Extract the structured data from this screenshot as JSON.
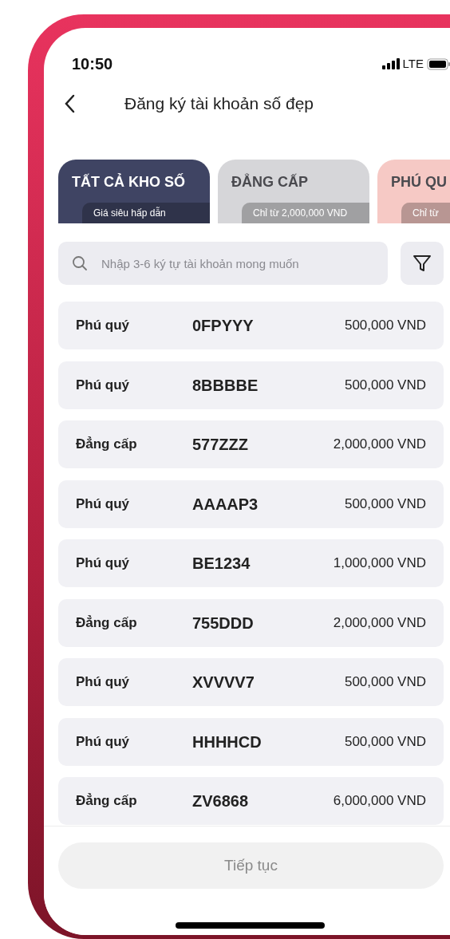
{
  "status_bar": {
    "time": "10:50",
    "network": "LTE"
  },
  "header": {
    "title": "Đăng ký tài khoản số đẹp"
  },
  "tabs": [
    {
      "label": "TẤT CẢ KHO SỐ",
      "subtitle": "Giá siêu hấp dẫn",
      "selected": true,
      "color": "#3f4463"
    },
    {
      "label": "ĐẲNG CẤP",
      "subtitle": "Chỉ từ 2,000,000 VND",
      "selected": false,
      "color": "#d6d6d9"
    },
    {
      "label": "PHÚ QU",
      "subtitle": "Chỉ từ",
      "selected": false,
      "color": "#f6c9c5"
    }
  ],
  "search": {
    "placeholder": "Nhập 3-6 ký tự tài khoản mong muốn"
  },
  "accounts": [
    {
      "category": "Phú quý",
      "number": "0FPYYY",
      "price": "500,000 VND"
    },
    {
      "category": "Phú quý",
      "number": "8BBBBE",
      "price": "500,000 VND"
    },
    {
      "category": "Đẳng cấp",
      "number": "577ZZZ",
      "price": "2,000,000 VND"
    },
    {
      "category": "Phú quý",
      "number": "AAAAP3",
      "price": "500,000 VND"
    },
    {
      "category": "Phú quý",
      "number": "BE1234",
      "price": "1,000,000 VND"
    },
    {
      "category": "Đẳng cấp",
      "number": "755DDD",
      "price": "2,000,000 VND"
    },
    {
      "category": "Phú quý",
      "number": "XVVVV7",
      "price": "500,000 VND"
    },
    {
      "category": "Phú quý",
      "number": "HHHHCD",
      "price": "500,000 VND"
    },
    {
      "category": "Đẳng cấp",
      "number": "ZV6868",
      "price": "6,000,000 VND"
    }
  ],
  "continue_button": {
    "label": "Tiếp tục",
    "disabled": true
  }
}
